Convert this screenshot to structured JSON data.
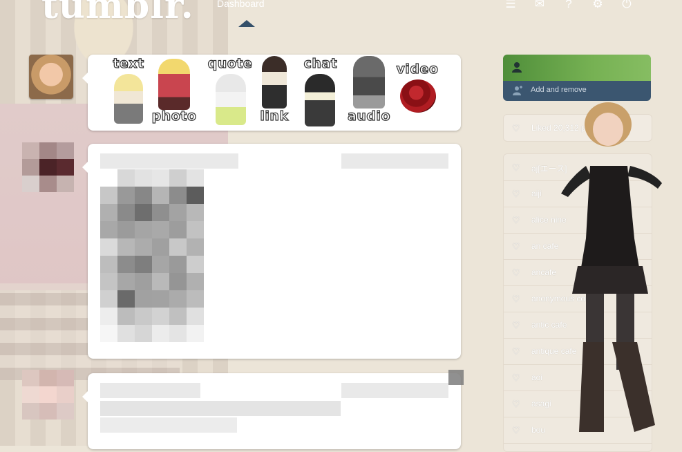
{
  "header": {
    "logo": "tumblr.",
    "nav_dashboard": "Dashboard",
    "icons": [
      "list-icon",
      "mail-icon",
      "help-icon",
      "gear-icon",
      "power-icon"
    ]
  },
  "post_types": [
    {
      "label": "text",
      "icon": "text-chibi-icon"
    },
    {
      "label": "photo",
      "icon": "photo-chibi-icon"
    },
    {
      "label": "quote",
      "icon": "quote-chibi-icon"
    },
    {
      "label": "link",
      "icon": "link-chibi-icon"
    },
    {
      "label": "chat",
      "icon": "chat-chibi-icon"
    },
    {
      "label": "audio",
      "icon": "audio-chibi-icon"
    },
    {
      "label": "video",
      "icon": "rose-icon"
    }
  ],
  "sidebar": {
    "add_remove": "Add and remove",
    "liked": "Liked 20,312 posts",
    "following": [
      "aj[エース]",
      "aiji",
      "alice nine",
      "an cafe",
      "ancafe",
      "anonymous confe...",
      "antic cafe",
      "antique cafe",
      "aoi",
      "asagi",
      "bou"
    ]
  },
  "colors": {
    "background": "#ece5d8",
    "nav_triangle": "#34506a",
    "green_header": "#6aa549",
    "add_remove_bg": "#3b5670"
  }
}
